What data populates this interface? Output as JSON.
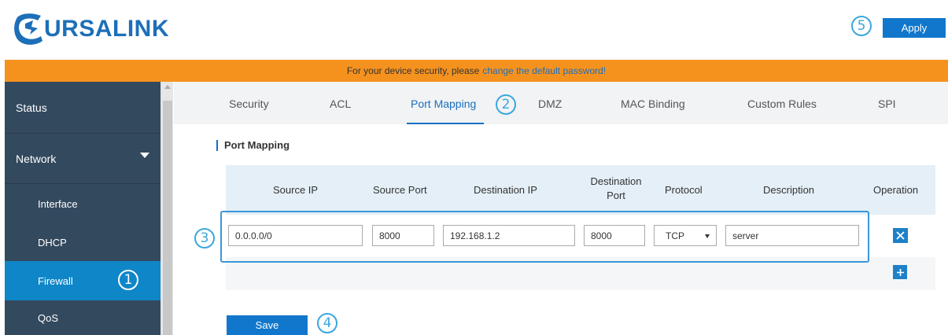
{
  "header": {
    "logo_text": "URSALINK",
    "apply_label": "Apply",
    "annotation_apply": "5"
  },
  "banner": {
    "text": "For your device security, please",
    "link_text": "change the default password!"
  },
  "sidebar": {
    "items": [
      {
        "label": "Status"
      },
      {
        "label": "Network"
      },
      {
        "label": "Interface"
      },
      {
        "label": "DHCP"
      },
      {
        "label": "Firewall"
      },
      {
        "label": "QoS"
      }
    ],
    "annotation_firewall": "1"
  },
  "tabs": {
    "items": [
      {
        "label": "Security"
      },
      {
        "label": "ACL"
      },
      {
        "label": "Port Mapping"
      },
      {
        "label": "DMZ"
      },
      {
        "label": "MAC Binding"
      },
      {
        "label": "Custom Rules"
      },
      {
        "label": "SPI"
      }
    ],
    "active": "Port Mapping",
    "annotation_tab": "2"
  },
  "section": {
    "title": "Port Mapping"
  },
  "table": {
    "headers": {
      "source_ip": "Source IP",
      "source_port": "Source Port",
      "destination_ip": "Destination IP",
      "destination_port_1": "Destination",
      "destination_port_2": "Port",
      "protocol": "Protocol",
      "description": "Description",
      "operation": "Operation"
    },
    "row": {
      "source_ip": "0.0.0.0/0",
      "source_port": "8000",
      "destination_ip": "192.168.1.2",
      "destination_port": "8000",
      "protocol": "TCP",
      "description": "server"
    },
    "annotation_row": "3",
    "delete_icon": "close-icon",
    "add_icon": "plus-icon"
  },
  "footer": {
    "save_label": "Save",
    "annotation_save": "4"
  },
  "colors": {
    "accent": "#1177cc",
    "banner": "#f5921e",
    "sidebar": "#33495e",
    "sidebar_active": "#0f86c7",
    "annotation": "#3aa7dd"
  }
}
